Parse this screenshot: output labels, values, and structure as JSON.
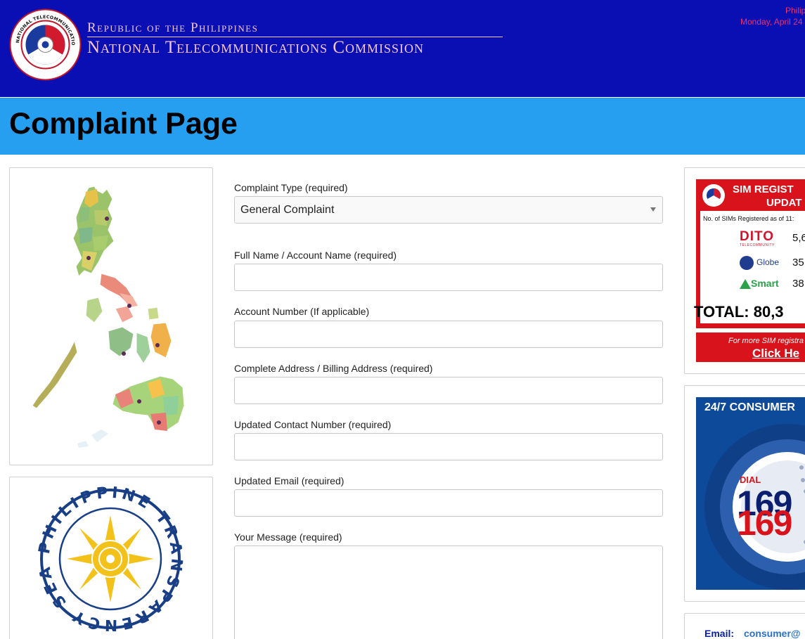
{
  "header": {
    "title_top": "Republic of the Philippines",
    "title_main": "National Telecommunications Commission",
    "logo_text": "NATIONAL TELECOMMUNICATIONS COMMISSION",
    "pst_label": "Philip",
    "date_text": "Monday, April 24",
    "header_color": "#0a0fb3",
    "title_color": "#f4c6d8"
  },
  "page": {
    "title": "Complaint Page",
    "titlebar_color": "#269ff0"
  },
  "form": {
    "complaint_type_label": "Complaint Type (required)",
    "complaint_type_value": "General Complaint",
    "full_name_label": "Full Name / Account Name (required)",
    "full_name_value": "",
    "account_number_label": "Account Number (If applicable)",
    "account_number_value": "",
    "address_label": "Complete Address / Billing Address (required)",
    "address_value": "",
    "contact_label": "Updated Contact Number (required)",
    "contact_value": "",
    "email_label": "Updated Email (required)",
    "email_value": "",
    "message_label": "Your Message (required)",
    "message_value": ""
  },
  "sidebar_left": {
    "map_alt": "Philippines map",
    "seal_text": "PHILIPPINE TRANSPARENCY SEAL"
  },
  "sim_update": {
    "heading_line1": "SIM REGIST",
    "heading_line2": "UPDAT",
    "as_of": "No. of SIMs Registered as of 11:",
    "telcos": [
      {
        "name": "DITO",
        "sub": "TELECOMMUNITY",
        "count": "5,6",
        "icon": "dito-logo"
      },
      {
        "name": "Globe",
        "count": "35",
        "icon": "globe-logo"
      },
      {
        "name": "Smart",
        "count": "38",
        "icon": "smart-logo"
      }
    ],
    "total": "TOTAL: 80,3",
    "more_text": "For more SIM registra",
    "click_text": "Click He",
    "accent_color": "#d9131b"
  },
  "hotline": {
    "heading": "24/7 CONSUMER",
    "dial_label": "DIAL",
    "number_top": "169",
    "number_bottom": "169",
    "bg_color": "#0d4a9a"
  },
  "contact": {
    "email_label": "Email:",
    "email_value": "consumer@"
  }
}
